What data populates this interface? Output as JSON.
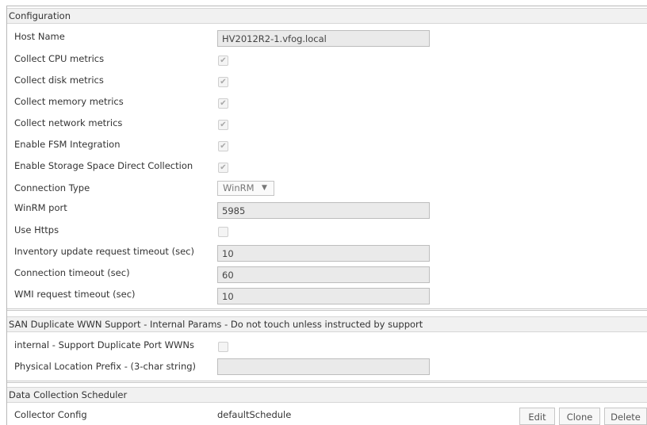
{
  "sections": {
    "configuration": "Configuration",
    "san": "SAN Duplicate WWN Support - Internal Params - Do not touch unless instructed by support",
    "scheduler": "Data Collection Scheduler"
  },
  "fields": {
    "host_name": {
      "label": "Host Name",
      "value": "HV2012R2-1.vfog.local"
    },
    "cpu": {
      "label": "Collect CPU metrics",
      "checked": true
    },
    "disk": {
      "label": "Collect disk metrics",
      "checked": true
    },
    "memory": {
      "label": "Collect memory metrics",
      "checked": true
    },
    "network": {
      "label": "Collect network metrics",
      "checked": true
    },
    "fsm": {
      "label": "Enable FSM Integration",
      "checked": true
    },
    "storage": {
      "label": "Enable Storage Space Direct Collection",
      "checked": true
    },
    "conn_type": {
      "label": "Connection Type",
      "value": "WinRM",
      "arrow": "▼"
    },
    "winrm_port": {
      "label": "WinRM port",
      "value": "5985"
    },
    "https": {
      "label": "Use Https",
      "checked": false
    },
    "inventory": {
      "label": "Inventory update request timeout (sec)",
      "value": "10"
    },
    "conn_timeout": {
      "label": "Connection timeout (sec)",
      "value": "60"
    },
    "wmi": {
      "label": "WMI request timeout (sec)",
      "value": "10"
    },
    "dup_wwn": {
      "label": "internal - Support Duplicate Port WWNs",
      "checked": false
    },
    "prefix": {
      "label": "Physical Location Prefix - (3-char string)",
      "value": ""
    }
  },
  "scheduler": {
    "label": "Collector Config",
    "value": "defaultSchedule",
    "edit": "Edit",
    "clone": "Clone",
    "delete": "Delete"
  },
  "check_glyph": "✔"
}
